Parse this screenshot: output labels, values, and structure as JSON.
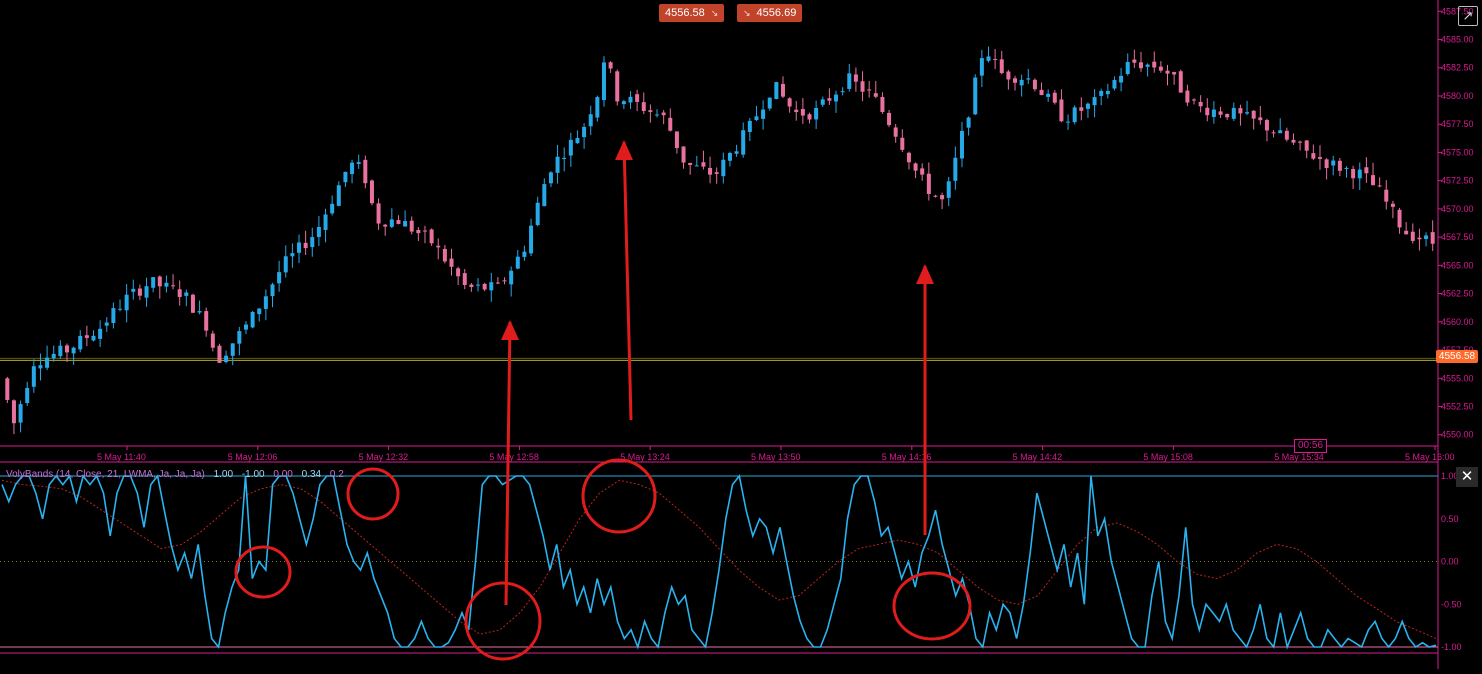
{
  "toolbar": {
    "sell_price": "4556.58",
    "buy_price": "4556.69",
    "detach_icon": "external-window-icon",
    "close_icon": "close-icon"
  },
  "colors": {
    "background": "#000000",
    "bull": "#26a9e8",
    "bear": "#e8719f",
    "axis": "#d81b93",
    "price_line": "#b0b020",
    "osc_line": "#29b3f0",
    "osc_signal": "#c0221c",
    "annotation": "#e01c1c"
  },
  "price_axis": {
    "ticks": [
      "4587.50",
      "4585.00",
      "4582.50",
      "4580.00",
      "4577.50",
      "4575.00",
      "4572.50",
      "4570.00",
      "4567.50",
      "4565.00",
      "4562.50",
      "4560.00",
      "4557.50",
      "4555.00",
      "4552.50",
      "4550.00"
    ],
    "last_price_label": "4556.58",
    "timer": "00:56"
  },
  "time_axis": {
    "ticks": [
      "5 May 11:40",
      "5 May 12:06",
      "5 May 12:32",
      "5 May 12:58",
      "5 May 13:24",
      "5 May 13:50",
      "5 May 14:16",
      "5 May 14:42",
      "5 May 15:08",
      "5 May 15:34",
      "5 May 16:00"
    ]
  },
  "indicator": {
    "name": "VolyBands (14, Close, 21, LWMA, Ja, Ja, Ja)",
    "values": [
      "1.00",
      "-1.00",
      "0.00",
      "0.34",
      "0.2"
    ],
    "axis_ticks": [
      "1.00",
      "0.50",
      "0.00",
      "-0.50",
      "-1.00"
    ]
  },
  "chart_data": [
    {
      "type": "candlestick",
      "title": "",
      "ylim": [
        4549.0,
        4588.5
      ],
      "last_price": 4556.58,
      "grid": false,
      "keypoints": [
        [
          0,
          4555.0
        ],
        [
          8,
          4551.0
        ],
        [
          20,
          4556.5
        ],
        [
          40,
          4557.5
        ],
        [
          60,
          4559.5
        ],
        [
          75,
          4562.0
        ],
        [
          90,
          4563.5
        ],
        [
          110,
          4562.5
        ],
        [
          125,
          4559.5
        ],
        [
          130,
          4556.5
        ],
        [
          150,
          4560.0
        ],
        [
          170,
          4565.0
        ],
        [
          190,
          4568.0
        ],
        [
          210,
          4574.0
        ],
        [
          218,
          4573.5
        ],
        [
          226,
          4569.0
        ],
        [
          240,
          4569.0
        ],
        [
          260,
          4567.0
        ],
        [
          280,
          4563.0
        ],
        [
          300,
          4563.0
        ],
        [
          315,
          4566.5
        ],
        [
          330,
          4573.5
        ],
        [
          350,
          4577.0
        ],
        [
          360,
          4580.5
        ],
        [
          364,
          4584.0
        ],
        [
          370,
          4580.0
        ],
        [
          380,
          4579.5
        ],
        [
          400,
          4578.0
        ],
        [
          412,
          4574.0
        ],
        [
          430,
          4573.0
        ],
        [
          450,
          4577.0
        ],
        [
          465,
          4581.0
        ],
        [
          478,
          4578.5
        ],
        [
          490,
          4578.5
        ],
        [
          510,
          4581.5
        ],
        [
          525,
          4580.0
        ],
        [
          540,
          4576.5
        ],
        [
          552,
          4573.0
        ],
        [
          560,
          4571.5
        ],
        [
          568,
          4570.5
        ],
        [
          585,
          4580.0
        ],
        [
          592,
          4584.5
        ],
        [
          602,
          4582.0
        ],
        [
          620,
          4581.5
        ],
        [
          640,
          4578.0
        ],
        [
          660,
          4579.5
        ],
        [
          680,
          4583.0
        ],
        [
          700,
          4582.5
        ],
        [
          720,
          4579.0
        ],
        [
          740,
          4578.5
        ],
        [
          760,
          4577.5
        ],
        [
          780,
          4575.5
        ],
        [
          800,
          4574.0
        ],
        [
          820,
          4573.0
        ],
        [
          830,
          4571.5
        ],
        [
          845,
          4568.0
        ],
        [
          862,
          4567.0
        ]
      ],
      "bars": 216
    },
    {
      "type": "line",
      "title": "",
      "ylim": [
        -1.0,
        1.0
      ],
      "series": [
        {
          "role": "oscillator",
          "values": [
            0.9,
            0.7,
            0.9,
            1.0,
            1.0,
            0.8,
            0.5,
            0.9,
            1.0,
            0.9,
            1.0,
            0.7,
            1.0,
            0.9,
            1.0,
            0.8,
            0.3,
            0.8,
            1.0,
            1.0,
            0.8,
            0.4,
            0.9,
            1.0,
            0.6,
            0.2,
            -0.1,
            0.1,
            -0.2,
            0.2,
            -0.4,
            -0.9,
            -1.0,
            -0.6,
            -0.3,
            -0.1,
            1.0,
            -0.2,
            0.0,
            -0.1,
            0.9,
            1.0,
            1.0,
            0.8,
            0.5,
            0.2,
            0.5,
            0.9,
            1.0,
            1.0,
            0.6,
            0.2,
            0.0,
            -0.1,
            0.1,
            -0.2,
            -0.4,
            -0.6,
            -0.9,
            -1.0,
            -1.0,
            -0.9,
            -0.7,
            -0.9,
            -1.0,
            -1.0,
            -0.95,
            -0.8,
            -0.6,
            -0.8,
            0.0,
            0.9,
            1.0,
            1.0,
            0.9,
            0.95,
            1.0,
            1.0,
            0.9,
            0.6,
            0.3,
            -0.1,
            0.2,
            -0.3,
            -0.1,
            -0.5,
            -0.3,
            -0.6,
            -0.2,
            -0.5,
            -0.3,
            -0.7,
            -0.9,
            -0.8,
            -1.0,
            -0.7,
            -0.9,
            -1.0,
            -0.6,
            -0.3,
            -0.5,
            -0.4,
            -0.8,
            -0.9,
            -1.0,
            -0.6,
            -0.1,
            0.5,
            0.9,
            1.0,
            0.6,
            0.3,
            0.5,
            0.4,
            0.1,
            0.4,
            0.0,
            -0.4,
            -0.7,
            -0.9,
            -1.0,
            -1.0,
            -0.8,
            -0.5,
            -0.2,
            0.5,
            0.9,
            1.0,
            1.0,
            0.7,
            0.3,
            0.4,
            0.1,
            -0.2,
            0.0,
            -0.3,
            0.1,
            0.3,
            0.6,
            0.2,
            -0.1,
            -0.4,
            -0.2,
            -0.5,
            -0.9,
            -1.0,
            -0.6,
            -0.8,
            -0.5,
            -0.6,
            -0.9,
            -0.5,
            0.1,
            0.8,
            0.5,
            0.2,
            -0.1,
            0.2,
            -0.3,
            0.1,
            -0.5,
            1.0,
            0.3,
            0.5,
            0.0,
            -0.3,
            -0.6,
            -0.9,
            -1.0,
            -1.0,
            -0.4,
            0.0,
            -0.7,
            -0.9,
            -0.4,
            0.4,
            -0.5,
            -0.8,
            -0.5,
            -0.6,
            -0.7,
            -0.5,
            -0.8,
            -0.9,
            -1.0,
            -0.8,
            -0.5,
            -0.9,
            -1.0,
            -0.6,
            -1.0,
            -0.8,
            -0.6,
            -0.9,
            -1.0,
            -1.0,
            -0.8,
            -0.9,
            -1.0,
            -0.9,
            -0.95,
            -1.0,
            -0.8,
            -0.7,
            -0.9,
            -1.0,
            -0.9,
            -0.7,
            -0.9,
            -1.0,
            -0.95,
            -1.0,
            -0.98
          ]
        },
        {
          "role": "signal",
          "values": [
            0.95,
            0.9,
            0.88,
            0.85,
            0.75,
            0.6,
            0.45,
            0.3,
            0.15,
            0.2,
            0.35,
            0.55,
            0.75,
            0.85,
            0.9,
            0.85,
            0.7,
            0.5,
            0.3,
            0.1,
            -0.1,
            -0.3,
            -0.5,
            -0.7,
            -0.85,
            -0.8,
            -0.6,
            -0.3,
            0.1,
            0.5,
            0.8,
            0.95,
            0.9,
            0.8,
            0.6,
            0.4,
            0.15,
            -0.1,
            -0.3,
            -0.45,
            -0.4,
            -0.2,
            0.0,
            0.15,
            0.2,
            0.25,
            0.2,
            0.1,
            -0.1,
            -0.3,
            -0.45,
            -0.5,
            -0.4,
            -0.1,
            0.2,
            0.4,
            0.45,
            0.35,
            0.2,
            0.0,
            -0.15,
            -0.2,
            -0.1,
            0.1,
            0.2,
            0.15,
            0.0,
            -0.2,
            -0.4,
            -0.55,
            -0.7,
            -0.8,
            -0.9
          ]
        }
      ]
    }
  ],
  "annotations": {
    "circles": 6,
    "arrows": 4
  }
}
